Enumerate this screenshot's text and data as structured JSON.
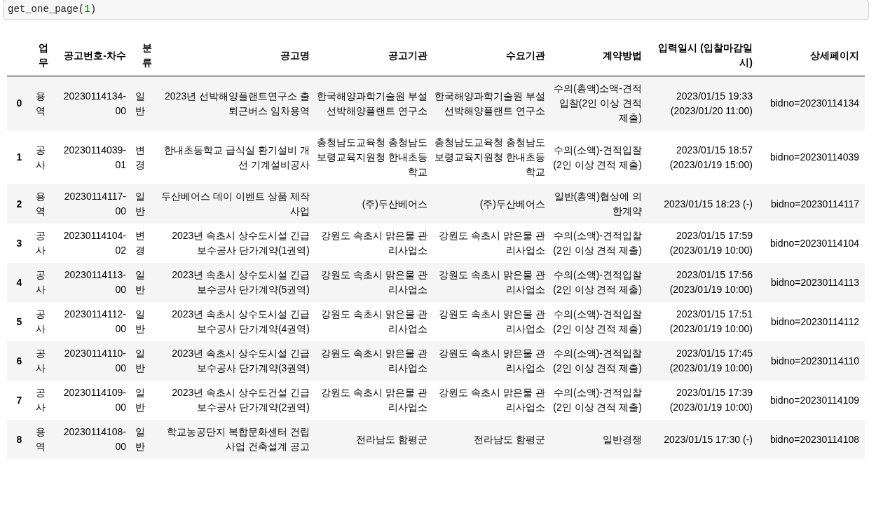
{
  "code_cell": {
    "tokens": [
      {
        "text": "get_one_page(",
        "kind": "plain"
      },
      {
        "text": "1",
        "kind": "number"
      },
      {
        "text": ")",
        "kind": "plain"
      }
    ]
  },
  "table": {
    "columns": [
      "",
      "업무",
      "공고번호-차수",
      "분류",
      "공고명",
      "공고기관",
      "수요기관",
      "계약방법",
      "입력일시 (입찰마감일시)",
      "상세페이지"
    ],
    "rows": [
      [
        "0",
        "용역",
        "20230114134-00",
        "일반",
        "2023년 선박해양플랜트연구소 출퇴근버스 임차용역",
        "한국해양과학기술원 부설 선박해양플랜트 연구소",
        "한국해양과학기술원 부설 선박해양플랜트 연구소",
        "수의(총액)소액-견적입찰(2인 이상 견적 제출)",
        "2023/01/15 19:33 (2023/01/20 11:00)",
        "bidno=20230114134"
      ],
      [
        "1",
        "공사",
        "20230114039-01",
        "변경",
        "한내초등학교 급식실 환기설비 개선 기계설비공사",
        "충청남도교육청 충청남도보령교육지원청 한내초등학교",
        "충청남도교육청 충청남도보령교육지원청 한내초등학교",
        "수의(소액)-견적입찰(2인 이상 견적 제출)",
        "2023/01/15 18:57 (2023/01/19 15:00)",
        "bidno=20230114039"
      ],
      [
        "2",
        "용역",
        "20230114117-00",
        "일반",
        "두산베어스 데이 이벤트 상품 제작 사업",
        "(주)두산베어스",
        "(주)두산베어스",
        "일반(총액)협상에 의한계약",
        "2023/01/15 18:23 (-)",
        "bidno=20230114117"
      ],
      [
        "3",
        "공사",
        "20230114104-02",
        "변경",
        "2023년 속초시 상수도시설 긴급 보수공사 단가계약(1권역)",
        "강원도 속초시 맑은물 관리사업소",
        "강원도 속초시 맑은물 관리사업소",
        "수의(소액)-견적입찰(2인 이상 견적 제출)",
        "2023/01/15 17:59 (2023/01/19 10:00)",
        "bidno=20230114104"
      ],
      [
        "4",
        "공사",
        "20230114113-00",
        "일반",
        "2023년 속초시 상수도시설 긴급 보수공사 단가계약(5권역)",
        "강원도 속초시 맑은물 관리사업소",
        "강원도 속초시 맑은물 관리사업소",
        "수의(소액)-견적입찰(2인 이상 견적 제출)",
        "2023/01/15 17:56 (2023/01/19 10:00)",
        "bidno=20230114113"
      ],
      [
        "5",
        "공사",
        "20230114112-00",
        "일반",
        "2023년 속초시 상수도시설 긴급 보수공사 단가계약(4권역)",
        "강원도 속초시 맑은물 관리사업소",
        "강원도 속초시 맑은물 관리사업소",
        "수의(소액)-견적입찰(2인 이상 견적 제출)",
        "2023/01/15 17:51 (2023/01/19 10:00)",
        "bidno=20230114112"
      ],
      [
        "6",
        "공사",
        "20230114110-00",
        "일반",
        "2023년 속초시 상수도시설 긴급 보수공사 단가계약(3권역)",
        "강원도 속초시 맑은물 관리사업소",
        "강원도 속초시 맑은물 관리사업소",
        "수의(소액)-견적입찰(2인 이상 견적 제출)",
        "2023/01/15 17:45 (2023/01/19 10:00)",
        "bidno=20230114110"
      ],
      [
        "7",
        "공사",
        "20230114109-00",
        "일반",
        "2023년 속초시 상수도건설 긴급 보수공사 단가계약(2권역)",
        "강원도 속초시 맑은물 관리사업소",
        "강원도 속초시 맑은물 관리사업소",
        "수의(소액)-견적입찰(2인 이상 견적 제출)",
        "2023/01/15 17:39 (2023/01/19 10:00)",
        "bidno=20230114109"
      ],
      [
        "8",
        "용역",
        "20230114108-00",
        "일반",
        "학교농공단지 복합문화센터 건립사업 건축설계 공고",
        "전라남도 함평군",
        "전라남도 함평군",
        "일반경쟁",
        "2023/01/15 17:30 (-)",
        "bidno=20230114108"
      ]
    ]
  }
}
